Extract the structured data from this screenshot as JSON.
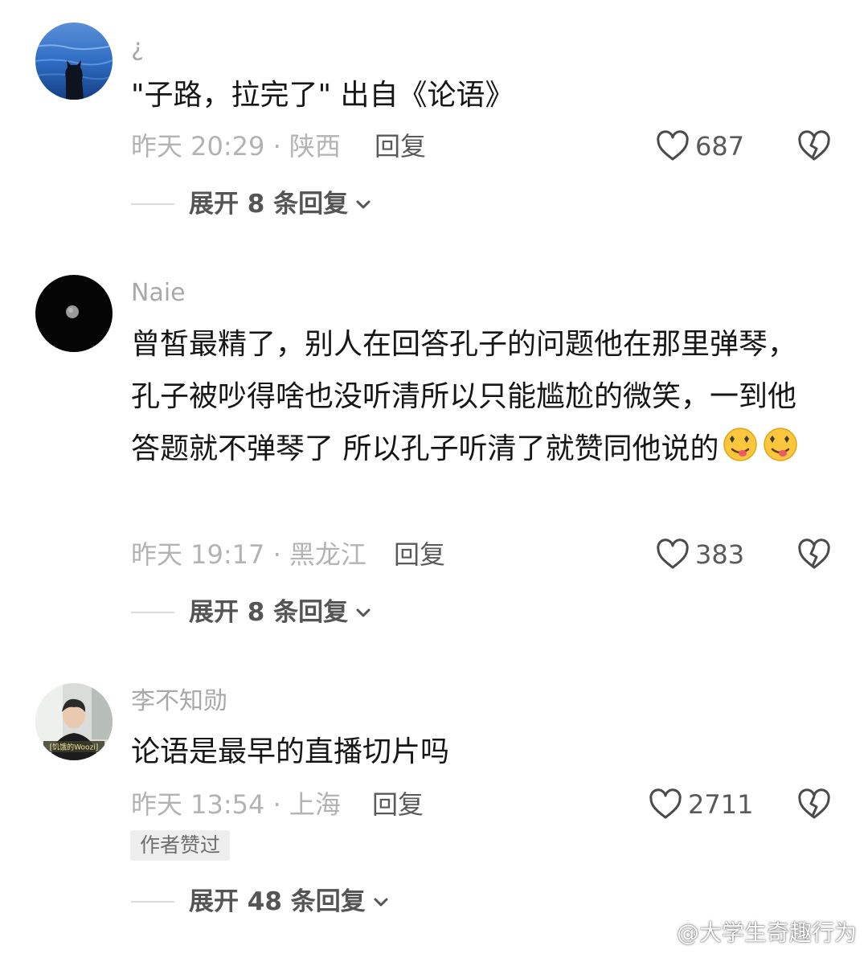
{
  "comments": [
    {
      "username": "¿",
      "text": "\"子路，拉完了\" 出自《论语》",
      "meta": "昨天 20:29 · 陕西",
      "reply_label": "回复",
      "likes": "687",
      "expand_label": "展开 8 条回复"
    },
    {
      "username": "Naie",
      "text": "曾皙最精了，别人在回答孔子的问题他在那里弹琴，孔子被吵得啥也没听清所以只能尴尬的微笑，一到他答题就不弹琴了 所以孔子听清了就赞同他说的",
      "meta": "昨天 19:17 · 黑龙江",
      "reply_label": "回复",
      "likes": "383",
      "expand_label": "展开 8 条回复"
    },
    {
      "username": "李不知勋",
      "avatar_caption": "[饥饿的Woozi]",
      "text": "论语是最早的直播切片吗",
      "meta": "昨天 13:54 · 上海",
      "reply_label": "回复",
      "likes": "2711",
      "author_liked": "作者赞过",
      "expand_label": "展开 48 条回复"
    }
  ],
  "watermark": "@大学生奇趣行为",
  "icons": {
    "like": "heart-outline-icon",
    "dislike": "broken-heart-icon",
    "expand": "chevron-down-icon",
    "emoji": "drooling-heart-eyes-emoji",
    "watermark": "weibo-logo-icon"
  }
}
